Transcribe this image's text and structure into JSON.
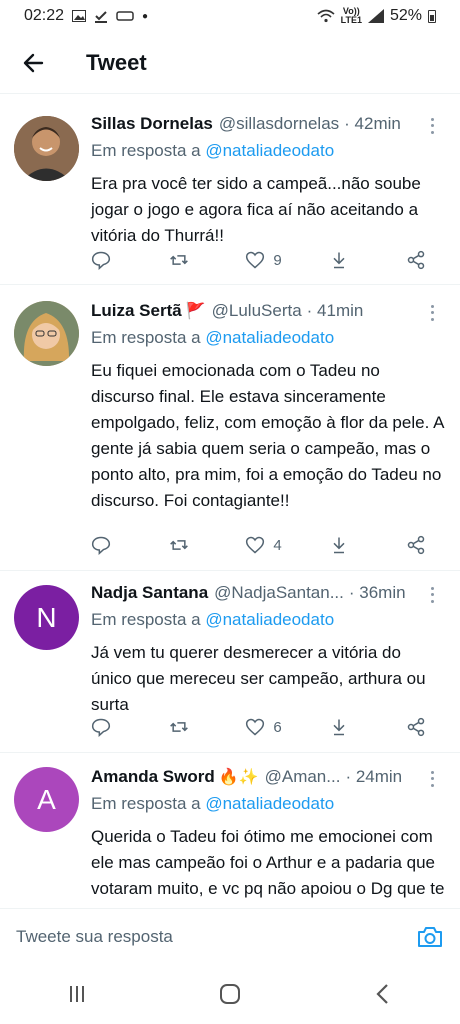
{
  "status_bar": {
    "time": "02:22",
    "volte": "Vo))",
    "lte": "LTE1",
    "battery": "52%"
  },
  "header": {
    "title": "Tweet"
  },
  "tweets": [
    {
      "name": "Sillas Dornelas",
      "emoji": "",
      "handle": "@sillasdornelas",
      "time": "· 42min",
      "reply_label": "Em resposta a",
      "reply_handle": "@nataliadeodato",
      "text": "Era pra você ter sido a campeã...não soube jogar o jogo e agora fica aí não aceitando a vitória do Thurrá!!",
      "likes": "9",
      "avatar_color": "#6b4f3a"
    },
    {
      "name": "Luiza Sertã",
      "emoji": "🚩",
      "handle": "@LuluSerta",
      "time": "· 41min",
      "reply_label": "Em resposta a",
      "reply_handle": "@nataliadeodato",
      "text": "Eu fiquei emocionada com o Tadeu no discurso final. Ele estava sinceramente empolgado, feliz, com emoção à flor da pele. A gente já sabia quem seria o campeão, mas o ponto alto, pra mim, foi a emoção do Tadeu no discurso. Foi contagiante!!",
      "likes": "4",
      "avatar_color": "#c9a06a"
    },
    {
      "name": "Nadja Santana",
      "emoji": "",
      "handle": "@NadjaSantan...",
      "time": "· 36min",
      "reply_label": "Em resposta a",
      "reply_handle": "@nataliadeodato",
      "text": "Já vem tu querer desmerecer a vitória do único que mereceu ser campeão, arthura ou surta",
      "likes": "6",
      "avatar_letter": "N",
      "avatar_color": "#7b1fa2"
    },
    {
      "name": "Amanda Sword",
      "emoji": "🔥✨",
      "handle": "@Aman...",
      "time": "· 24min",
      "reply_label": "Em resposta a",
      "reply_handle": "@nataliadeodato",
      "text": "Querida o Tadeu foi ótimo me emocionei com ele mas campeão foi o Arthur e a padaria que votaram muito, e vc pq não apoiou o Dg que te deu tanto apoio dentro",
      "likes": "",
      "avatar_letter": "A",
      "avatar_color": "#ab47bc"
    }
  ],
  "composer": {
    "placeholder": "Tweete sua resposta"
  },
  "colors": {
    "accent": "#1d9bf0",
    "secondary_text": "#536471",
    "border": "#eff3f4"
  }
}
